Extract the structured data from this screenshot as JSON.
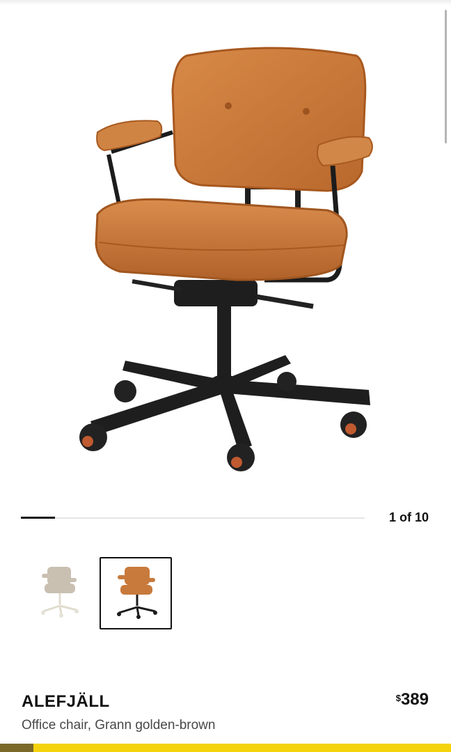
{
  "gallery": {
    "current": 1,
    "total": 10,
    "counter_text": "1 of 10",
    "progress_fraction": 0.1
  },
  "thumbnails": [
    {
      "variant": "beige",
      "selected": false
    },
    {
      "variant": "golden-brown",
      "selected": true
    }
  ],
  "product": {
    "name": "ALEFJÄLL",
    "description": "Office chair, Grann golden-brown",
    "price_currency": "$",
    "price_amount": "389"
  },
  "colors": {
    "accent_yellow": "#f4d20c",
    "leather": "#c67a3c",
    "frame": "#1c1c1c"
  }
}
